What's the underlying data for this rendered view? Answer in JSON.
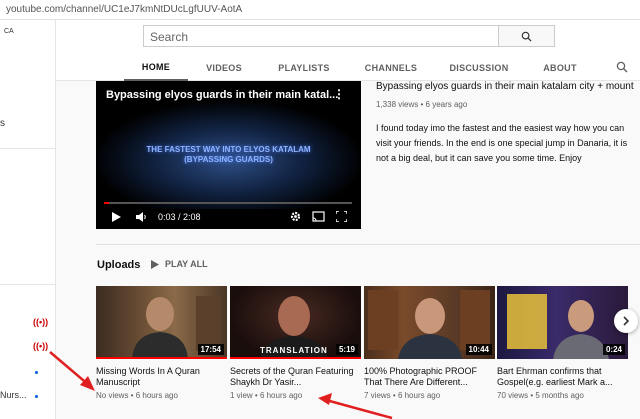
{
  "browser": {
    "url": "youtube.com/channel/UC1eJ7kmNtDUcLgfUUV-AotA"
  },
  "search": {
    "placeholder": "Search"
  },
  "sidebar": {
    "region_badge": "CA",
    "partial_label": "s",
    "subscription_partial": "Nurs..."
  },
  "tabs": [
    {
      "label": "HOME",
      "active": true
    },
    {
      "label": "VIDEOS"
    },
    {
      "label": "PLAYLISTS"
    },
    {
      "label": "CHANNELS"
    },
    {
      "label": "DISCUSSION"
    },
    {
      "label": "ABOUT"
    }
  ],
  "featured": {
    "player_title": "Bypassing elyos guards in their main katal...",
    "overlay_line1": "THE FASTEST WAY INTO ELYOS KATALAM",
    "overlay_line2": "(BYPASSING GUARDS)",
    "time": "0:03 / 2:08",
    "progress": 0.02,
    "title": "Bypassing elyos guards in their main katalam city + mount ju",
    "views": "1,338 views",
    "age": "6 years ago",
    "description": "I found today imo the fastest and the easiest way how you can visit your friends. In the end is one special jump in Danaria, it is not a big deal, but it can save you some time. Enjoy"
  },
  "uploads": {
    "title": "Uploads",
    "play_all": "PLAY ALL",
    "items": [
      {
        "title": "Missing Words In A Quran Manuscript",
        "duration": "17:54",
        "views": "No views",
        "age": "6 hours ago"
      },
      {
        "title": "Secrets of the Quran Featuring Shaykh Dr Yasir...",
        "duration": "5:19",
        "caption": "TRANSLATION",
        "views": "1 view",
        "age": "6 hours ago"
      },
      {
        "title": "100% Photographic PROOF That There Are Different...",
        "duration": "10:44",
        "views": "7 views",
        "age": "6 hours ago"
      },
      {
        "title": "Bart Ehrman confirms that Gospel(e.g. earliest Mark a...",
        "duration": "0:24",
        "views": "70 views",
        "age": "5 months ago"
      }
    ]
  },
  "colors": {
    "accent_red": "#ff0000",
    "arrow_red": "#e02020",
    "muted_text": "#606060"
  }
}
